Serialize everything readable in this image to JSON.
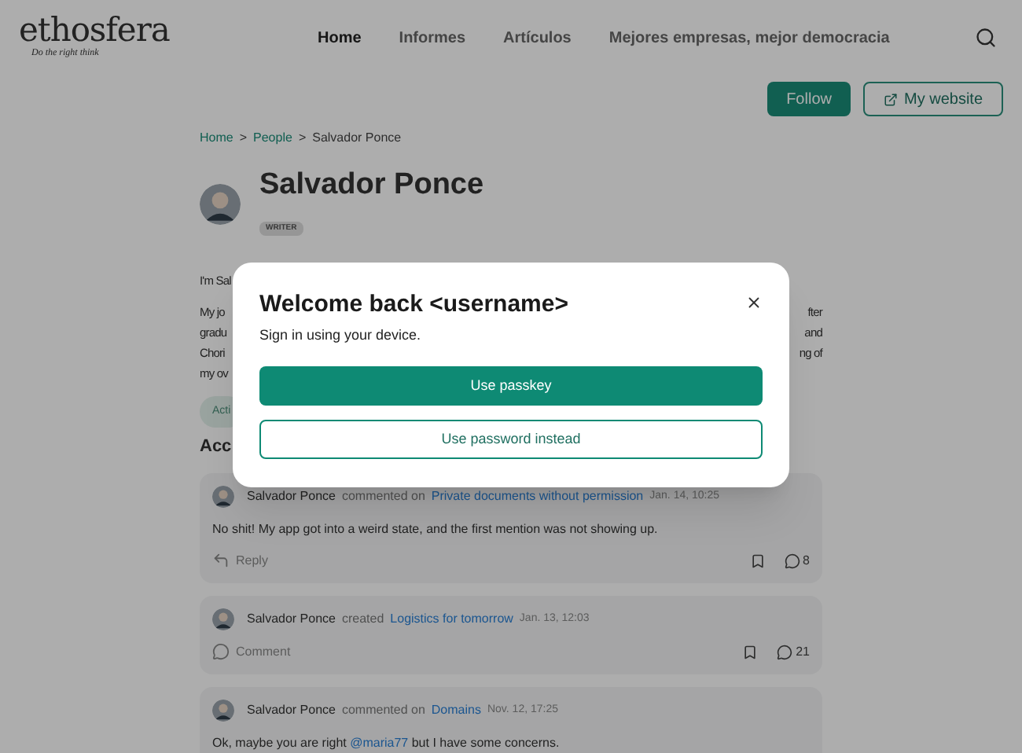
{
  "header": {
    "logo": "ethosfera",
    "tagline": "Do the right think",
    "nav": [
      {
        "label": "Home",
        "selected": true
      },
      {
        "label": "Informes",
        "selected": false
      },
      {
        "label": "Artículos",
        "selected": false
      },
      {
        "label": "Mejores empresas, mejor democracia",
        "selected": false
      }
    ]
  },
  "actions": {
    "follow": "Follow",
    "website": "My website"
  },
  "breadcrumb": {
    "links": [
      "Home",
      "People"
    ],
    "separator": ">",
    "current": "Salvador Ponce"
  },
  "profile": {
    "name": "Salvador Ponce",
    "role": "WRITER"
  },
  "bio_lines": [
    {
      "left": "I'm Sal"
    },
    {
      "left": "My jo",
      "right": "fter"
    },
    {
      "left": "gradu",
      "right": "and"
    },
    {
      "left": "Chori",
      "right": "ng of"
    },
    {
      "left": "my ov"
    }
  ],
  "tag": "Acti",
  "section_heading": "Acc",
  "modal": {
    "title": "Welcome back <username>",
    "subtitle": "Sign in using your device.",
    "primary": "Use passkey",
    "secondary": "Use password instead"
  },
  "activity": [
    {
      "author": "Salvador Ponce",
      "action": "commented on",
      "target": "Private documents without permission",
      "time": "Jan. 14, 10:25",
      "body": [
        {
          "kind": "text",
          "text": "No shit! My app got into a weird state, and the first mention was not showing up."
        }
      ],
      "footer": {
        "kind": "reply",
        "label": "Reply"
      },
      "count": "8"
    },
    {
      "author": "Salvador Ponce",
      "action": "created",
      "target": "Logistics for tomorrow",
      "time": "Jan. 13, 12:03",
      "footer": {
        "kind": "comment",
        "label": "Comment"
      },
      "count": "21"
    },
    {
      "author": "Salvador Ponce",
      "action": "commented on",
      "target": "Domains",
      "time": "Nov. 12, 17:25",
      "body": [
        {
          "kind": "text",
          "text": "Ok, maybe you are right "
        },
        {
          "kind": "mention",
          "text": "@maria77"
        },
        {
          "kind": "text",
          "text": " but I have some concerns."
        }
      ]
    }
  ]
}
